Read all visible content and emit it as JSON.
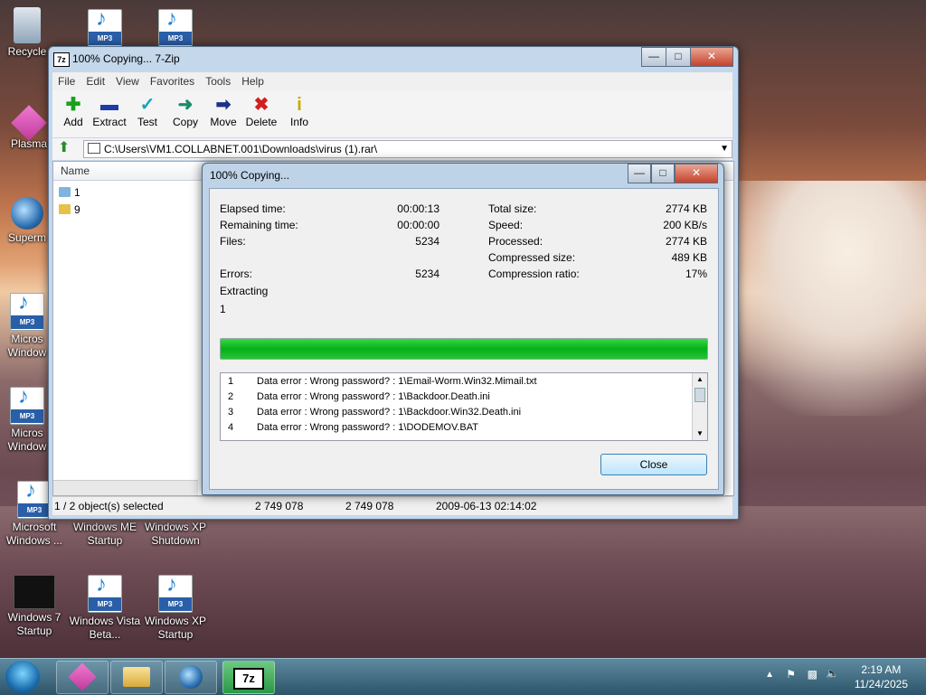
{
  "desktop": {
    "icons": [
      {
        "label": "Recycle"
      },
      {
        "label": "Plasma"
      },
      {
        "label": "Superm"
      },
      {
        "label": "Micros Window"
      },
      {
        "label": "Micros Window"
      },
      {
        "label": "Microsoft Windows ..."
      },
      {
        "label": "Windows ME Startup"
      },
      {
        "label": "Windows XP Shutdown"
      },
      {
        "label": "Windows 7 Startup"
      },
      {
        "label": "Windows Vista Beta..."
      },
      {
        "label": "Windows XP Startup"
      }
    ],
    "mp3_badge": "MP3"
  },
  "main_window": {
    "title": "100% Copying... 7-Zip",
    "icon_text": "7z",
    "menu": [
      "File",
      "Edit",
      "View",
      "Favorites",
      "Tools",
      "Help"
    ],
    "toolbar": [
      {
        "label": "Add",
        "icon": "plus-icon",
        "color": "#1aa11a"
      },
      {
        "label": "Extract",
        "icon": "minus-icon",
        "color": "#1d3ca8"
      },
      {
        "label": "Test",
        "icon": "check-icon",
        "color": "#19a3b8"
      },
      {
        "label": "Copy",
        "icon": "copy-arrow-icon",
        "color": "#1a8a6a"
      },
      {
        "label": "Move",
        "icon": "move-arrow-icon",
        "color": "#1d2f8a"
      },
      {
        "label": "Delete",
        "icon": "delete-x-icon",
        "color": "#d02020"
      },
      {
        "label": "Info",
        "icon": "info-icon",
        "color": "#c9a800"
      }
    ],
    "address": "C:\\Users\\VM1.COLLABNET.001\\Downloads\\virus (1).rar\\",
    "column_name": "Name",
    "files": [
      {
        "name": "1",
        "color": "#7fb3e0"
      },
      {
        "name": "9",
        "color": "#e8c04a"
      }
    ],
    "status": {
      "selected": "1 / 2 object(s) selected",
      "size": "2 749 078",
      "packed": "2 749 078",
      "modified": "2009-06-13 02:14:02"
    }
  },
  "dialog": {
    "title": "100% Copying...",
    "left_stats": [
      {
        "label": "Elapsed time:",
        "value": "00:00:13"
      },
      {
        "label": "Remaining time:",
        "value": "00:00:00"
      },
      {
        "label": "Files:",
        "value": "5234"
      },
      {
        "label": "Errors:",
        "value": "5234"
      }
    ],
    "right_stats": [
      {
        "label": "Total size:",
        "value": "2774 KB"
      },
      {
        "label": "Speed:",
        "value": "200 KB/s"
      },
      {
        "label": "Processed:",
        "value": "2774 KB"
      },
      {
        "label": "Compressed size:",
        "value": "489 KB"
      },
      {
        "label": "Compression ratio:",
        "value": "17%"
      }
    ],
    "action": "Extracting",
    "current_item": "1",
    "progress_percent": 100,
    "log": [
      {
        "n": "1",
        "text": "Data error : Wrong password? : 1\\Email-Worm.Win32.Mimail.txt"
      },
      {
        "n": "2",
        "text": "Data error : Wrong password? : 1\\Backdoor.Death.ini"
      },
      {
        "n": "3",
        "text": "Data error : Wrong password? : 1\\Backdoor.Win32.Death.ini"
      },
      {
        "n": "4",
        "text": "Data error : Wrong password? : 1\\DODEMOV.BAT"
      }
    ],
    "close_label": "Close"
  },
  "taskbar": {
    "time": "2:19 AM",
    "date": "11/24/2025",
    "active_app_label": "7z"
  }
}
